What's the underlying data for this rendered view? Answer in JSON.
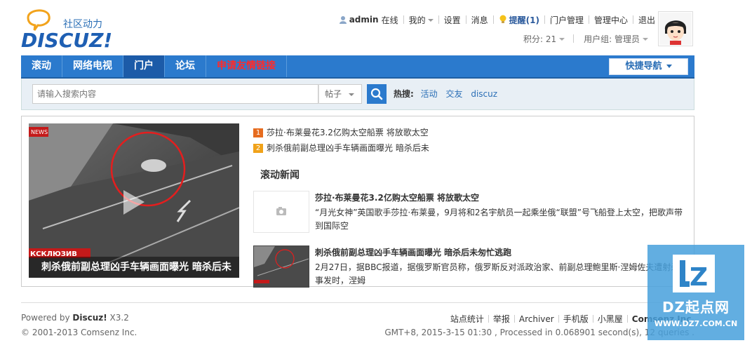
{
  "logo": {
    "brand": "DISCUZ!",
    "slogan": "社区动力"
  },
  "userbar": {
    "username": "admin",
    "status": "在线",
    "my": "我的",
    "settings": "设置",
    "messages": "消息",
    "remind": "提醒(1)",
    "portal_admin": "门户管理",
    "admin_center": "管理中心",
    "logout": "退出",
    "credits": "积分: 21",
    "usergroup": "用户组: 管理员"
  },
  "nav": {
    "items": [
      {
        "label": "滚动"
      },
      {
        "label": "网络电视"
      },
      {
        "label": "门户"
      },
      {
        "label": "论坛"
      },
      {
        "label": "申请友情链接"
      }
    ],
    "quicknav": "快捷导航"
  },
  "search": {
    "placeholder": "请输入搜索内容",
    "type": "帖子",
    "hot_label": "热搜:",
    "hot_tags": [
      "活动",
      "交友",
      "discuz"
    ]
  },
  "slide": {
    "caption": "刺杀俄前副总理凶手车辆画面曝光 暗杀后未",
    "overlay": "КСКЛЮЗИВ",
    "badge": "NEWS"
  },
  "top_list": [
    {
      "num": "1",
      "title": "莎拉·布莱曼花3.2亿购太空船票 将放歌太空"
    },
    {
      "num": "2",
      "title": "刺杀俄前副总理凶手车辆画面曝光 暗杀后未"
    }
  ],
  "section_title": "滚动新闻",
  "news": [
    {
      "title": "莎拉·布莱曼花3.2亿购太空船票 将放歌太空",
      "summary": "“月光女神”英国歌手莎拉·布莱曼，9月将和2名宇航员一起乘坐俄“联盟”号飞船登上太空，把歌声带到国际空"
    },
    {
      "title": "刺杀俄前副总理凶手车辆画面曝光 暗杀后未匆忙逃跑",
      "summary": "2月27日，据BBC报道，据俄罗斯官员称，俄罗斯反对派政治家、前副总理鲍里斯·涅姆佐夫遭射杀一事发时，涅姆"
    }
  ],
  "footer": {
    "powered_prefix": "Powered by ",
    "powered_brand": "Discuz!",
    "version": " X3.2",
    "copyright": "© 2001-2013 Comsenz Inc.",
    "links": [
      "站点统计",
      "举报",
      "Archiver",
      "手机版",
      "小黑屋"
    ],
    "corp": "Comsenz Inc.",
    "debug": "GMT+8, 2015-3-15 01:30 , Processed in 0.068901 second(s), 12 queries ."
  },
  "watermark": {
    "logo": "Z",
    "cn": "DZ起点网",
    "url": "WWW.DZ7.COM.CN"
  },
  "colors": {
    "nav": "#2b7acd",
    "nav_active": "#1c5ba8",
    "hot_link": "#ff2a2a",
    "link": "#2b6fb6"
  }
}
